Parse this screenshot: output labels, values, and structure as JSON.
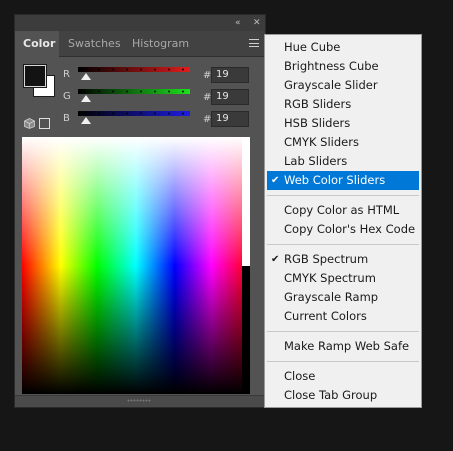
{
  "panel": {
    "collapse_icon": "«",
    "close_icon": "✕",
    "tabs": [
      {
        "label": "Color",
        "active": true
      },
      {
        "label": "Swatches",
        "active": false
      },
      {
        "label": "Histogram",
        "active": false
      }
    ],
    "menu_icon": "hamburger-icon",
    "foreground_color": "#131313",
    "background_color": "#ffffff",
    "channels": [
      {
        "label": "R",
        "value": "19",
        "slider_level": 0.075,
        "color": "#e21c1c"
      },
      {
        "label": "G",
        "value": "19",
        "slider_level": 0.075,
        "color": "#1ce21c"
      },
      {
        "label": "B",
        "value": "19",
        "slider_level": 0.075,
        "color": "#1c1ce2"
      }
    ],
    "hash_sign": "#",
    "spectrum": "RGB Spectrum"
  },
  "menu": {
    "groups": [
      {
        "items": [
          {
            "label": "Hue Cube",
            "checked": false,
            "selected": false
          },
          {
            "label": "Brightness Cube",
            "checked": false,
            "selected": false
          },
          {
            "label": "Grayscale Slider",
            "checked": false,
            "selected": false
          },
          {
            "label": "RGB Sliders",
            "checked": false,
            "selected": false
          },
          {
            "label": "HSB Sliders",
            "checked": false,
            "selected": false
          },
          {
            "label": "CMYK Sliders",
            "checked": false,
            "selected": false
          },
          {
            "label": "Lab Sliders",
            "checked": false,
            "selected": false
          },
          {
            "label": "Web Color Sliders",
            "checked": true,
            "selected": true
          }
        ]
      },
      {
        "items": [
          {
            "label": "Copy Color as HTML",
            "checked": false,
            "selected": false
          },
          {
            "label": "Copy Color's Hex Code",
            "checked": false,
            "selected": false
          }
        ]
      },
      {
        "items": [
          {
            "label": "RGB Spectrum",
            "checked": true,
            "selected": false
          },
          {
            "label": "CMYK Spectrum",
            "checked": false,
            "selected": false
          },
          {
            "label": "Grayscale Ramp",
            "checked": false,
            "selected": false
          },
          {
            "label": "Current Colors",
            "checked": false,
            "selected": false
          }
        ]
      },
      {
        "items": [
          {
            "label": "Make Ramp Web Safe",
            "checked": false,
            "selected": false
          }
        ]
      },
      {
        "items": [
          {
            "label": "Close",
            "checked": false,
            "selected": false
          },
          {
            "label": "Close Tab Group",
            "checked": false,
            "selected": false
          }
        ]
      }
    ],
    "check_glyph": "✔",
    "accent": "#0078d7"
  }
}
